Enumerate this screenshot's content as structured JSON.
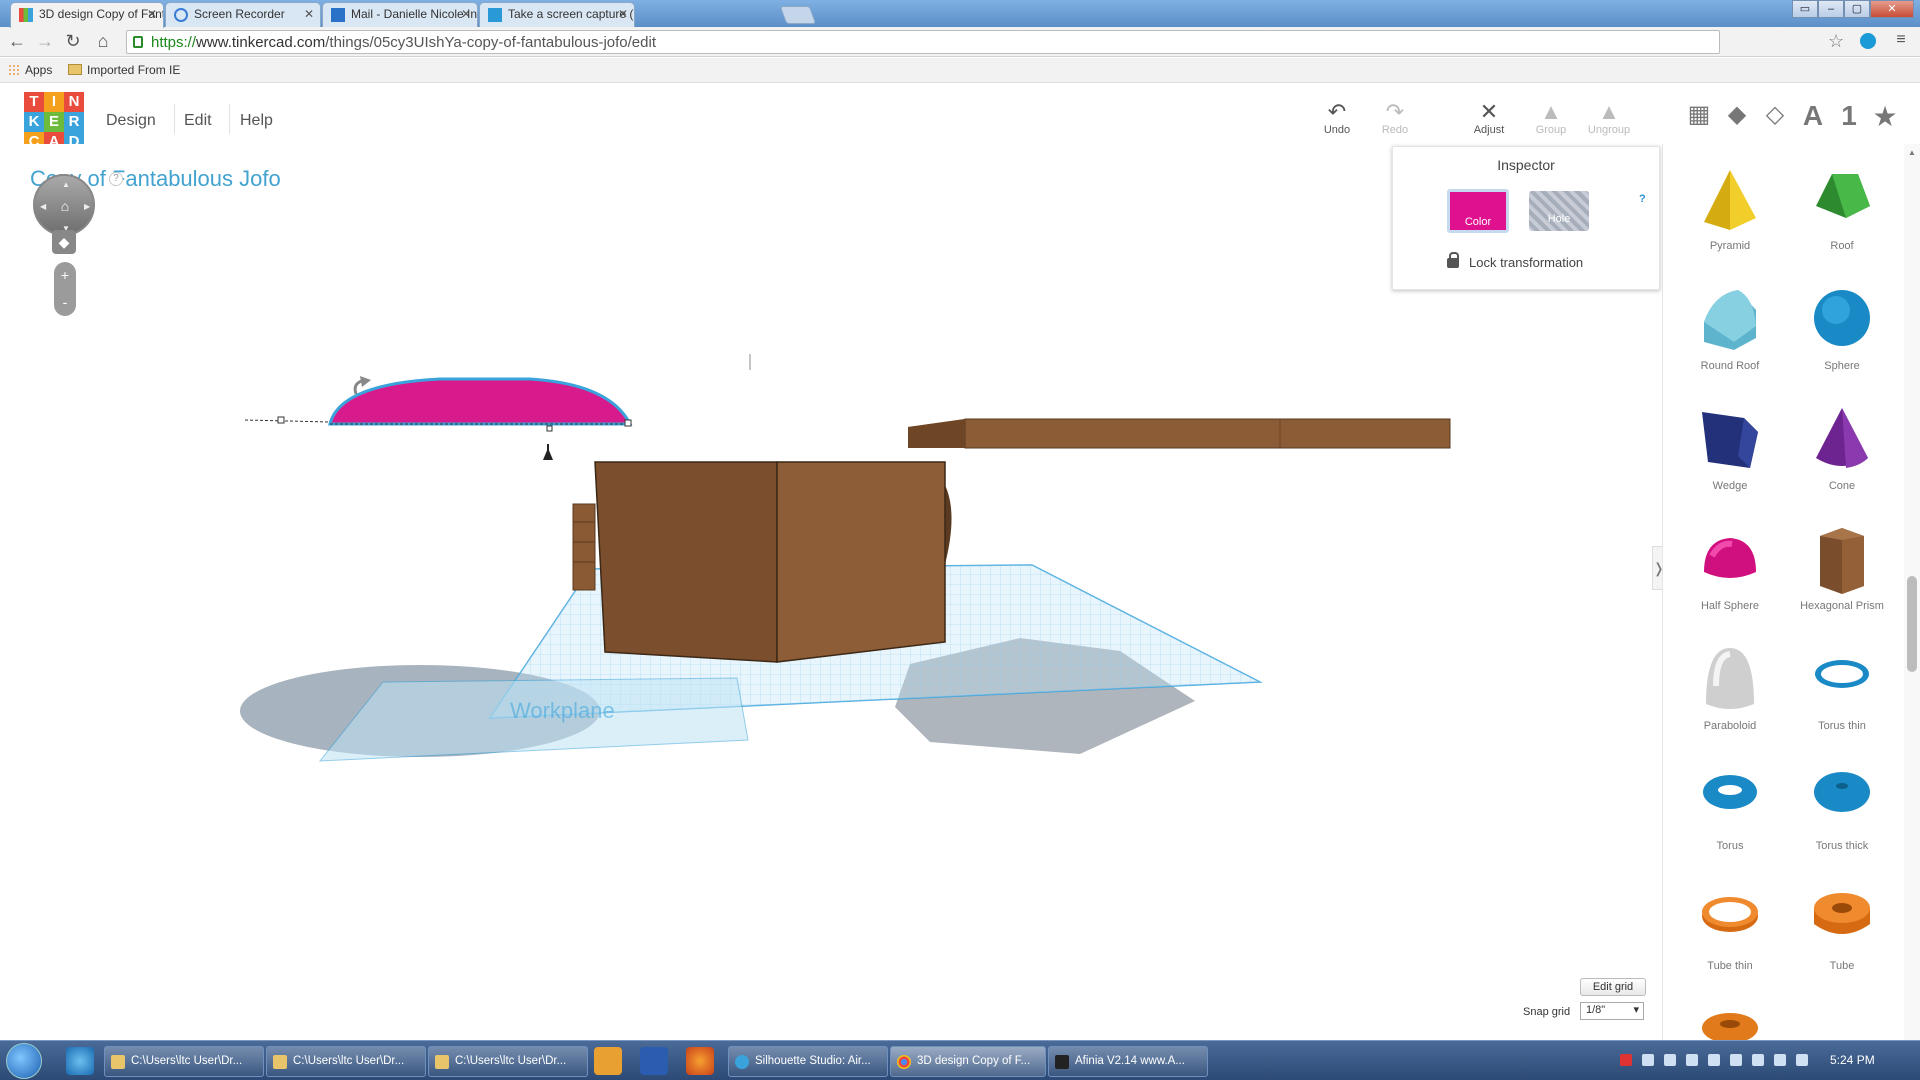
{
  "browser": {
    "tabs": [
      {
        "label": "3D design Copy of Fantab",
        "active": true
      },
      {
        "label": "Screen Recorder",
        "active": false
      },
      {
        "label": "Mail - Danielle Nicole Ing",
        "active": false
      },
      {
        "label": "Take a screen capture (pr",
        "active": false
      }
    ],
    "url_scheme": "https://",
    "url_host": "www.tinkercad.com",
    "url_path": "/things/05cy3UIshYa-copy-of-fantabulous-jofo/edit",
    "bookmarks": [
      {
        "label": "Apps"
      },
      {
        "label": "Imported From IE"
      }
    ]
  },
  "tinkercad": {
    "logo_letters": [
      "T",
      "I",
      "N",
      "K",
      "E",
      "R",
      "C",
      "A",
      "D"
    ],
    "logo_colors": [
      "#e94b3c",
      "#f4a01c",
      "#e94b3c",
      "#3aa3dc",
      "#6cbb3c",
      "#3aa3dc",
      "#f4a01c",
      "#e94b3c",
      "#3aa3dc"
    ],
    "menu": [
      "Design",
      "Edit",
      "Help"
    ],
    "toolbar": {
      "undo": "Undo",
      "redo": "Redo",
      "adjust": "Adjust",
      "group": "Group",
      "ungroup": "Ungroup"
    },
    "view_icons": [
      "grid-view-icon",
      "cube-view-icon",
      "wireframe-view-icon",
      "text-icon",
      "number-icon",
      "favorites-icon"
    ],
    "view_glyphs": [
      "A",
      "1",
      "★"
    ],
    "design_title": "Copy of Fantabulous Jofo",
    "help_mark": "?",
    "zoom_in": "+",
    "zoom_out": "-",
    "inspector": {
      "title": "Inspector",
      "color_label": "Color",
      "hole_label": "Hole",
      "help": "?",
      "lock_label": "Lock transformation",
      "selected_color": "#e0118f"
    },
    "workplane_label": "Workplane",
    "grid": {
      "edit_label": "Edit grid",
      "snap_label": "Snap grid",
      "snap_value": "1/8\""
    },
    "shapes": [
      {
        "label": "Pyramid",
        "color": "#e8c21a"
      },
      {
        "label": "Roof",
        "color": "#3aa63a"
      },
      {
        "label": "Round Roof",
        "color": "#6cc4d8"
      },
      {
        "label": "Sphere",
        "color": "#1a9ad6"
      },
      {
        "label": "Wedge",
        "color": "#2a3a8c"
      },
      {
        "label": "Cone",
        "color": "#7a2a9c"
      },
      {
        "label": "Half Sphere",
        "color": "#e0118f"
      },
      {
        "label": "Hexagonal Prism",
        "color": "#8a5a34"
      },
      {
        "label": "Paraboloid",
        "color": "#d8d8d8"
      },
      {
        "label": "Torus thin",
        "color": "#1a9ad6"
      },
      {
        "label": "Torus",
        "color": "#1a9ad6"
      },
      {
        "label": "Torus thick",
        "color": "#1a9ad6"
      },
      {
        "label": "Tube thin",
        "color": "#e07a1a"
      },
      {
        "label": "Tube",
        "color": "#e07a1a"
      }
    ]
  },
  "taskbar": {
    "tasks": [
      {
        "label": "C:\\Users\\ltc User\\Dr..."
      },
      {
        "label": "C:\\Users\\ltc User\\Dr..."
      },
      {
        "label": "C:\\Users\\ltc User\\Dr..."
      },
      {
        "label": "Silhouette Studio: Air..."
      },
      {
        "label": "3D design Copy of F..."
      },
      {
        "label": "Afinia  V2.14  www.A..."
      }
    ],
    "clock": "5:24 PM"
  }
}
